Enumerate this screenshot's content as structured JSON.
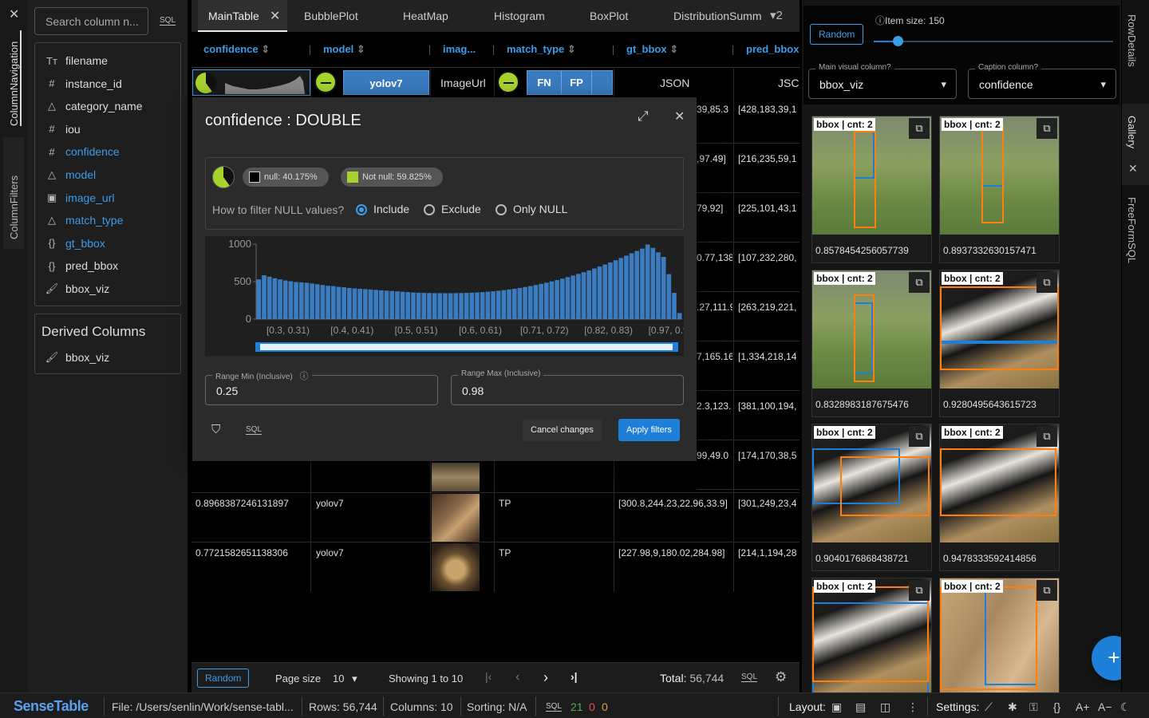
{
  "left_sidebar": {
    "tabs": [
      "ColumnNavigation",
      "ColumnFilters"
    ],
    "search_placeholder": "Search column n...",
    "sql_label": "SQL",
    "columns": [
      {
        "name": "filename",
        "icon": "text-type-icon",
        "color": "#dddddd"
      },
      {
        "name": "instance_id",
        "icon": "hash-icon",
        "color": "#dddddd"
      },
      {
        "name": "category_name",
        "icon": "shapes-icon",
        "color": "#dddddd"
      },
      {
        "name": "iou",
        "icon": "hash-icon",
        "color": "#dddddd"
      },
      {
        "name": "confidence",
        "icon": "hash-icon",
        "color": "#3b9ce8"
      },
      {
        "name": "model",
        "icon": "shapes-icon",
        "color": "#3b9ce8"
      },
      {
        "name": "image_url",
        "icon": "image-icon",
        "color": "#3b9ce8"
      },
      {
        "name": "match_type",
        "icon": "shapes-icon",
        "color": "#3b9ce8"
      },
      {
        "name": "gt_bbox",
        "icon": "braces-icon",
        "color": "#3b9ce8"
      },
      {
        "name": "pred_bbox",
        "icon": "braces-icon",
        "color": "#dddddd"
      },
      {
        "name": "bbox_viz",
        "icon": "brush-icon",
        "color": "#dddddd"
      }
    ],
    "derived_title": "Derived Columns",
    "derived_columns": [
      {
        "name": "bbox_viz",
        "icon": "brush-icon"
      }
    ]
  },
  "tabs": {
    "items": [
      "MainTable",
      "BubblePlot",
      "HeatMap",
      "Histogram",
      "BoxPlot",
      "DistributionSumm"
    ],
    "more_count": "2"
  },
  "table": {
    "headers": [
      "confidence",
      "model",
      "imag...",
      "match_type",
      "gt_bbox",
      "pred_bbox"
    ],
    "filter_row": {
      "model": "yolov7",
      "image": "ImageUrl",
      "match": [
        "FN",
        "FP"
      ],
      "gt": "JSON",
      "pred": "JSC"
    },
    "partial_rows": [
      {
        "gt": "39,85.3",
        "pred": "[428,183,39,1"
      },
      {
        "gt": ",97.49]",
        "pred": "[216,235,59,1"
      },
      {
        "gt": "79,92]",
        "pred": "[225,101,43,1"
      },
      {
        "gt": "0.77,138",
        "pred": "[107,232,280,"
      },
      {
        "gt": ".27,111.9",
        "pred": "[263,219,221,"
      },
      {
        "gt": "7,165.16",
        "pred": "[1,334,218,14"
      },
      {
        "gt": "2.3,123.",
        "pred": "[381,100,194,"
      },
      {
        "gt": "99,49.0",
        "pred": "[174,170,38,5"
      }
    ],
    "rows": [
      {
        "confidence": "0.8968387246131897",
        "model": "yolov7",
        "match": "TP",
        "gt": "[300.8,244.23,22.96,33.9]",
        "pred": "[301,249,23,4"
      },
      {
        "confidence": "0.7721582651138306",
        "model": "yolov7",
        "match": "TP",
        "gt": "[227.98,9,180.02,284.98]",
        "pred": "[214,1,194,28"
      }
    ]
  },
  "footer": {
    "random": "Random",
    "page_size_label": "Page size",
    "page_size": "10",
    "showing": "Showing 1 to 10",
    "total_label": "Total:",
    "total": "56,744",
    "sql": "SQL"
  },
  "modal": {
    "title": "confidence : DOUBLE",
    "null_chip": "null: 40.175%",
    "notnull_chip": "Not null: 59.825%",
    "null_question": "How to filter NULL values?",
    "options": [
      "Include",
      "Exclude",
      "Only NULL"
    ],
    "selected_option": "Include",
    "range_min_label": "Range Min (Inclusive)",
    "range_min": "0.25",
    "range_max_label": "Range Max (Inclusive)",
    "range_max": "0.98",
    "sql": "SQL",
    "cancel": "Cancel changes",
    "apply": "Apply filters"
  },
  "chart_data": {
    "type": "bar",
    "ylim": [
      0,
      1000
    ],
    "yticks": [
      "1000",
      "500",
      "0"
    ],
    "xtick_labels": [
      "[0.3, 0.31)",
      "[0.4, 0.41)",
      "[0.5, 0.51)",
      "[0.6, 0.61)",
      "[0.71, 0.72)",
      "[0.82, 0.83)",
      "[0.97, 0.98)"
    ],
    "values": [
      530,
      585,
      565,
      545,
      530,
      515,
      505,
      495,
      490,
      485,
      475,
      465,
      455,
      445,
      440,
      430,
      425,
      415,
      410,
      405,
      400,
      395,
      390,
      385,
      380,
      375,
      370,
      365,
      360,
      355,
      352,
      350,
      348,
      347,
      346,
      346,
      346,
      347,
      348,
      350,
      353,
      356,
      360,
      365,
      371,
      378,
      386,
      395,
      405,
      416,
      428,
      441,
      455,
      470,
      486,
      503,
      521,
      540,
      560,
      581,
      603,
      626,
      650,
      675,
      701,
      728,
      756,
      785,
      815,
      846,
      878,
      910,
      940,
      995,
      950,
      890,
      830,
      600,
      350,
      80
    ],
    "accent": "#3b7bbf"
  },
  "gallery": {
    "random": "Random",
    "item_size_label": "Item size: 150",
    "item_size_fraction": 0.1,
    "main_visual_label": "Main visual column?",
    "main_visual_value": "bbox_viz",
    "caption_label": "Caption column?",
    "caption_value": "confidence",
    "cards": [
      {
        "badge": "bbox | cnt: 2",
        "caption": "0.8578454256057739",
        "scene": "dog"
      },
      {
        "badge": "bbox | cnt: 2",
        "caption": "0.8937332630157471",
        "scene": "dog"
      },
      {
        "badge": "bbox | cnt: 2",
        "caption": "0.8328983187675476",
        "scene": "dog"
      },
      {
        "badge": "bbox | cnt: 2",
        "caption": "0.9280495643615723",
        "scene": "cow"
      },
      {
        "badge": "bbox | cnt: 2",
        "caption": "0.9040176868438721",
        "scene": "cow"
      },
      {
        "badge": "bbox | cnt: 2",
        "caption": "0.9478333592414856",
        "scene": "cow"
      },
      {
        "badge": "bbox | cnt: 2",
        "caption": "",
        "scene": "cow"
      },
      {
        "badge": "bbox | cnt: 2",
        "caption": "",
        "scene": "sand"
      }
    ]
  },
  "right_tabs": [
    "RowDetails",
    "Gallery",
    "FreeFormSQL"
  ],
  "status": {
    "brand": "SenseTable",
    "file": "File: /Users/senlin/Work/sense-tabl...",
    "rows": "Rows: 56,744",
    "columns": "Columns: 10",
    "sorting": "Sorting: N/A",
    "sql": "SQL",
    "count_green": "21",
    "count_red": "0",
    "count_orange": "0",
    "layout": "Layout:",
    "settings": "Settings:"
  }
}
